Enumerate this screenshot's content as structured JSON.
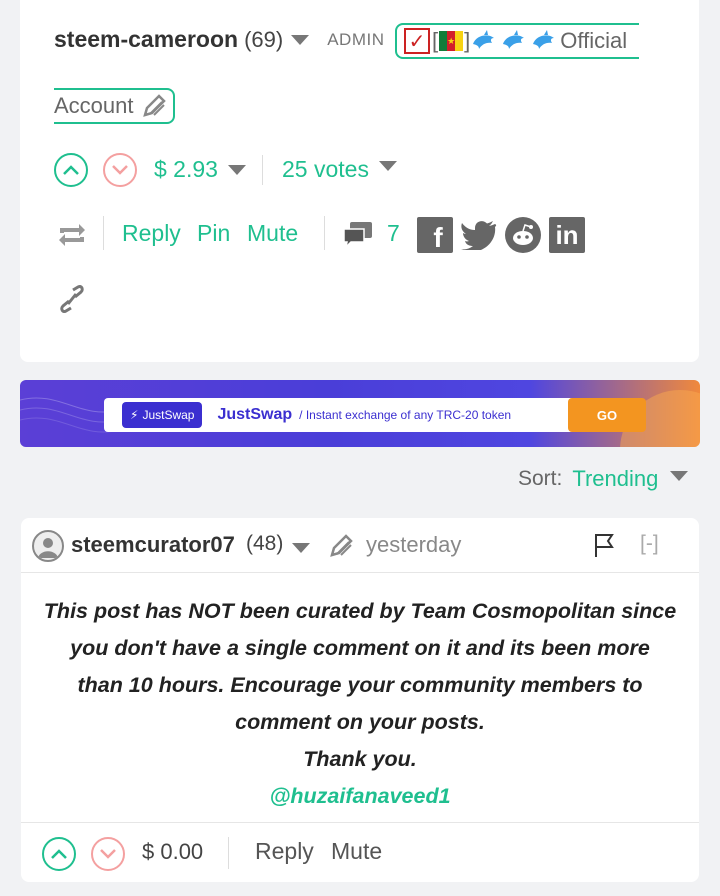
{
  "post": {
    "author": "steem-cameroon",
    "reputation": "(69)",
    "role": "ADMIN",
    "title_part1": "Official",
    "title_part2": "Account",
    "payout": "$ 2.93",
    "votes": "25 votes",
    "actions": {
      "reply": "Reply",
      "pin": "Pin",
      "mute": "Mute"
    },
    "comment_count": "7"
  },
  "banner": {
    "pill": "JustSwap",
    "name": "JustSwap",
    "tagline": "/ Instant exchange of any TRC-20 token",
    "cta": "GO"
  },
  "sort": {
    "label": "Sort:",
    "value": "Trending"
  },
  "comment": {
    "author": "steemcurator07",
    "reputation": "(48)",
    "time": "yesterday",
    "collapse": "[-]",
    "body_lines": [
      "This post has NOT been curated by Team Cosmopolitan since",
      "you don't have a single comment on it and its been more",
      "than 10 hours. Encourage your community members to",
      "comment on your posts.",
      "Thank you."
    ],
    "mention": "@huzaifanaveed1",
    "payout": "$ 0.00",
    "actions": {
      "reply": "Reply",
      "mute": "Mute"
    }
  },
  "colors": {
    "accent": "#1fbf8f",
    "downvote": "#f4a0a0",
    "banner": "#4a3ed8"
  }
}
